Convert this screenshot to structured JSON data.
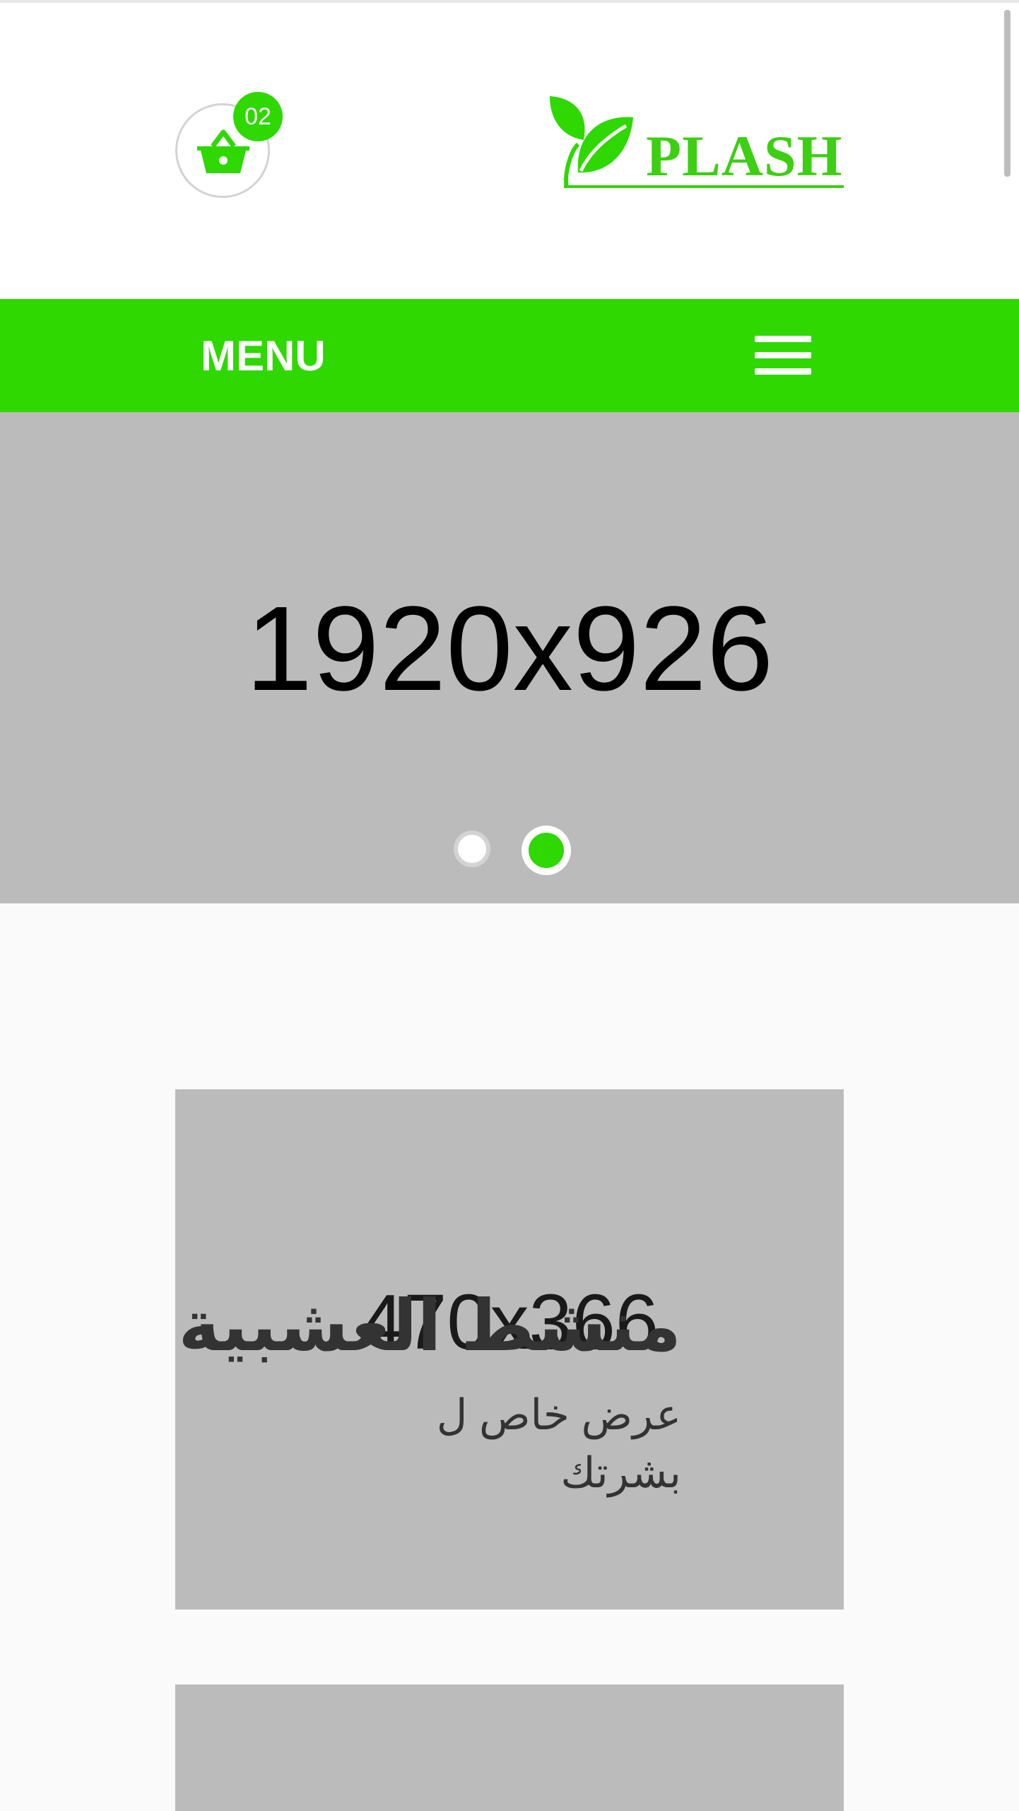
{
  "header": {
    "cart_count": "02",
    "logo_text": "PLASH"
  },
  "menubar": {
    "label": "MENU"
  },
  "hero": {
    "placeholder": "1920x926",
    "slides": 2,
    "active_slide": 2
  },
  "cards": [
    {
      "placeholder": "470x366",
      "title": "منشط العشبية",
      "subtitle": "عرض خاص ل بشرتك"
    }
  ],
  "colors": {
    "accent": "#2ed800",
    "placeholder_bg": "#bbbbbb",
    "page_bg": "#fafafa"
  },
  "icons": [
    "basket-icon",
    "leaf-logo-icon",
    "hamburger-icon"
  ]
}
